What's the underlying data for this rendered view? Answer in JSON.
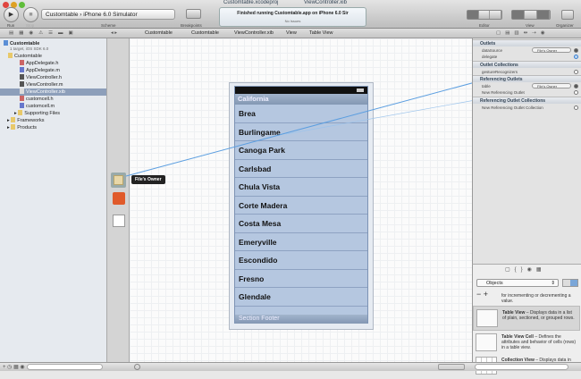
{
  "toolbar": {
    "run": "Run",
    "stop": "Stop",
    "scheme_project": "Customtable",
    "scheme_device": "iPhone 6.0 Simulator",
    "scheme_label": "Scheme",
    "breakpoints": "Breakpoints",
    "status_title": "Finished running Customtable.app on iPhone 6.0 Sir",
    "status_sub": "No Issues",
    "editor": "Editor",
    "view": "View",
    "organizer": "Organizer",
    "tab1": "Customtable.xcodeproj",
    "tab2": "ViewController.xib"
  },
  "jumpbar": [
    "Customtable",
    "Customtable",
    "ViewController.xib",
    "View",
    "Table View"
  ],
  "navigator": {
    "project": "Customtable",
    "project_sub": "1 target, iOS SDK 6.0",
    "group": "Customtable",
    "files": [
      "AppDelegate.h",
      "AppDelegate.m",
      "ViewController.h",
      "ViewController.m",
      "ViewController.xib",
      "customcell.h",
      "customcell.m"
    ],
    "supporting": "Supporting Files",
    "frameworks": "Frameworks",
    "products": "Products"
  },
  "dock": {
    "files_owner": "File's Owner"
  },
  "table": {
    "header": "California",
    "rows": [
      "Brea",
      "Burlingame",
      "Canoga Park",
      "Carlsbad",
      "Chula Vista",
      "Corte Madera",
      "Costa Mesa",
      "Emeryville",
      "Escondido",
      "Fresno",
      "Glendale"
    ],
    "footer": "Section Footer"
  },
  "inspector": {
    "outlets": "Outlets",
    "datasource": "dataSource",
    "datasource_target": "File's Owner",
    "delegate": "delegate",
    "outlet_collections": "Outlet Collections",
    "gesture": "gestureRecognizers",
    "referencing": "Referencing Outlets",
    "table": "table",
    "table_target": "File's Owner",
    "new_ref": "New Referencing Outlet",
    "ref_collections": "Referencing Outlet Collections",
    "new_ref_coll": "New Referencing Outlet Collection"
  },
  "library": {
    "selector": "Objects",
    "stepper_desc": "for incrementing or decrementing a value.",
    "items": [
      {
        "title": "Table View",
        "desc": " – Displays data in a list of plain, sectioned, or grouped rows."
      },
      {
        "title": "Table View Cell",
        "desc": " – Defines the attributes and behavior of cells (rows) in a table view."
      },
      {
        "title": "Collection View",
        "desc": " – Displays data in"
      }
    ]
  },
  "colors": {
    "accent": "#4a8fd8",
    "table_bg": "#b5c7e0"
  }
}
